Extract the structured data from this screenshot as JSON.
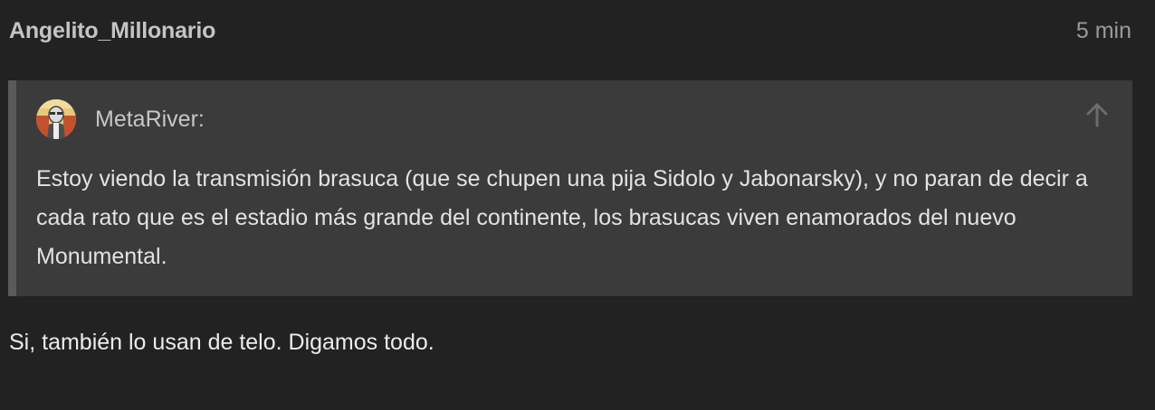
{
  "post": {
    "username": "Angelito_Millonario",
    "date": "5 min",
    "quote": {
      "username": "MetaRiver:",
      "text": "Estoy viendo la transmisión brasuca (que se chupen una pija Sidolo y Jabonarsky), y no paran de decir a cada rato que es el estadio más grande del continente, los brasucas viven enamorados del nuevo Monumental.",
      "avatar_icon": "user-avatar",
      "expand_icon": "arrow-up-icon"
    },
    "body": "Si, también lo usan de telo. Digamos todo."
  },
  "colors": {
    "background": "#222222",
    "quote_background": "#3b3b3b",
    "quote_border": "#5a5a5a"
  }
}
